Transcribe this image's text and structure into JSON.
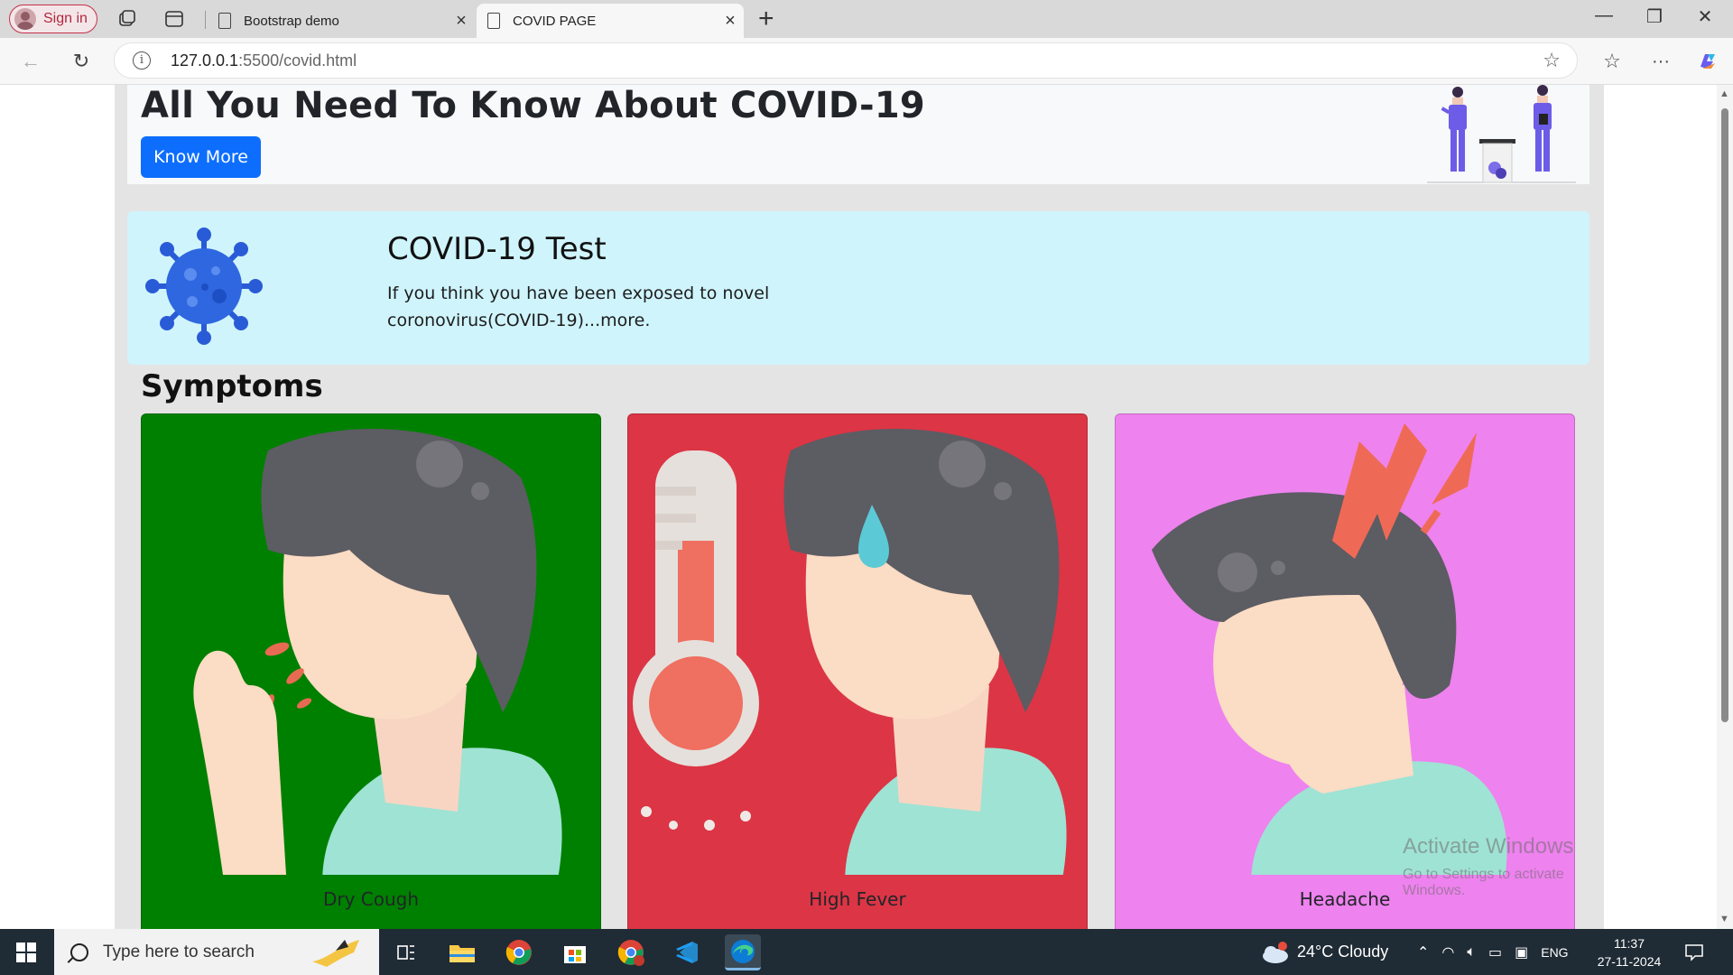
{
  "browser": {
    "sign_in_label": "Sign in",
    "tabs": [
      {
        "title": "Bootstrap demo",
        "active": false
      },
      {
        "title": "COVID PAGE",
        "active": true
      }
    ],
    "url_host": "127.0.0.1",
    "url_rest": ":5500/covid.html"
  },
  "page": {
    "hero": {
      "title": "All You Need To Know About COVID-19",
      "button_label": "Know More"
    },
    "test_alert": {
      "title": "COVID-19 Test",
      "text": "If you think you have been exposed to novel coronovirus(COVID-19)...more."
    },
    "symptoms": {
      "heading": "Symptoms",
      "cards": [
        {
          "caption": "Dry Cough",
          "bg": "#008000"
        },
        {
          "caption": "High Fever",
          "bg": "#dc3545"
        },
        {
          "caption": "Headache",
          "bg": "#ee82ee"
        }
      ]
    },
    "watermark": {
      "title": "Activate Windows",
      "subtitle": "Go to Settings to activate Windows."
    }
  },
  "taskbar": {
    "search_placeholder": "Type here to search",
    "weather": "24°C  Cloudy",
    "language": "ENG",
    "time": "11:37",
    "date": "27-11-2024"
  },
  "colors": {
    "primary": "#0d6efd",
    "alert_bg": "#cff4fc"
  }
}
